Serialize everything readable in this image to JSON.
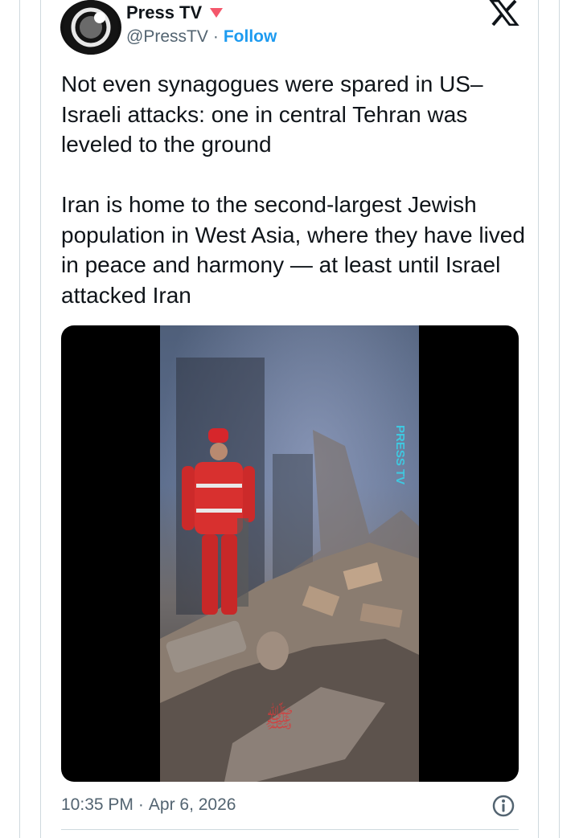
{
  "author": {
    "display_name": "Press TV",
    "handle": "@PressTV",
    "separator": "·",
    "follow_label": "Follow",
    "badge_icon": "red-down-triangle-icon",
    "avatar_icon": "press-tv-logo"
  },
  "header": {
    "logo_icon": "x-logo-icon"
  },
  "tweet": {
    "text": "Not even synagogues were spared in US–Israeli attacks: one in central Tehran was leveled to the ground\n\nIran is home to the second-largest Jewish population in West Asia, where they have lived in peace and harmony — at least until Israel attacked Iran"
  },
  "media": {
    "watermark_text": "PRESS TV"
  },
  "footer": {
    "time": "10:35 PM",
    "separator": "·",
    "date": "Apr 6, 2026",
    "info_icon": "info-circle-icon"
  },
  "colors": {
    "follow": "#1d9bf0",
    "secondary_text": "#536471",
    "badge": "#f4576b",
    "border": "#cfd9de"
  }
}
